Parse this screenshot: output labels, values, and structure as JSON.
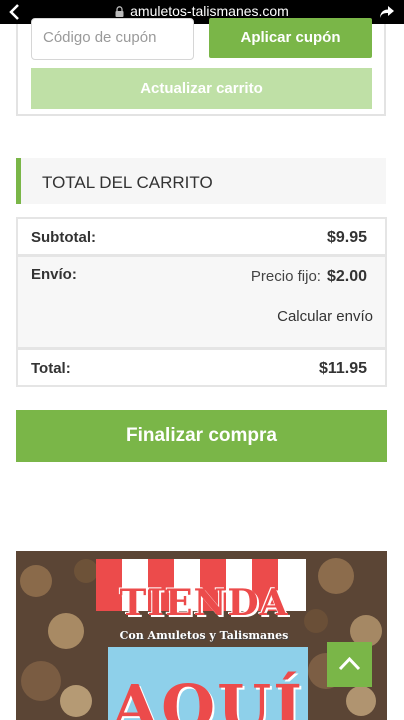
{
  "browser": {
    "url": "amuletos-talismanes.com"
  },
  "coupon": {
    "placeholder": "Código de cupón",
    "apply_label": "Aplicar cupón",
    "update_label": "Actualizar carrito"
  },
  "totals": {
    "heading": "TOTAL DEL CARRITO",
    "subtotal_label": "Subtotal:",
    "subtotal_value": "$9.95",
    "shipping_label": "Envío:",
    "shipping_method": "Precio fijo:",
    "shipping_value": "$2.00",
    "calc_shipping": "Calcular envío",
    "total_label": "Total:",
    "total_value": "$11.95",
    "checkout_label": "Finalizar compra"
  },
  "banner": {
    "title": "TIENDA",
    "subtitle": "Con Amuletos y Talismanes",
    "cta": "AQUÍ"
  },
  "colors": {
    "accent": "#7ab648",
    "accent_light": "#bfe0a6",
    "banner_red": "#ec4b4b"
  }
}
